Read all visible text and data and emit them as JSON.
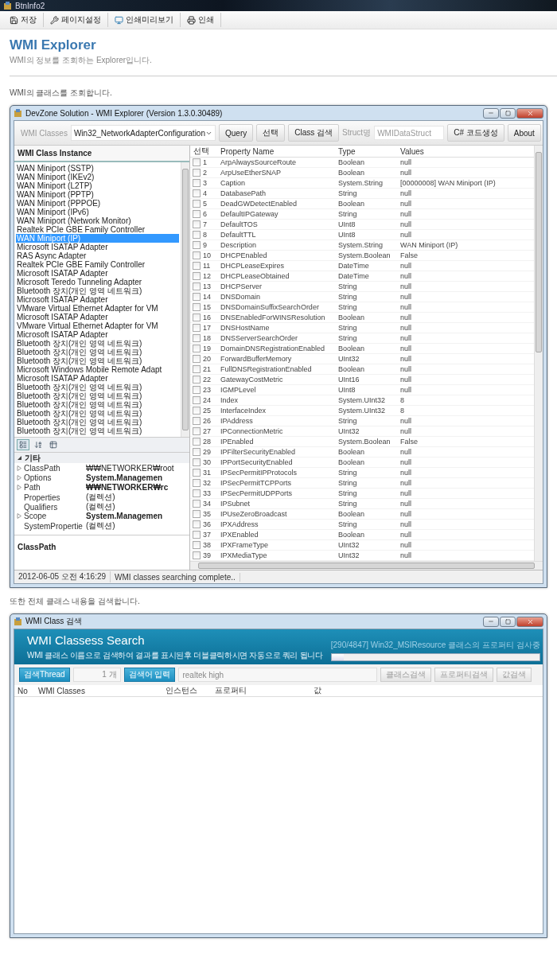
{
  "app": {
    "title": "BtnInfo2",
    "toolbar": [
      {
        "label": "저장"
      },
      {
        "label": "페이지설정"
      },
      {
        "label": "인쇄미리보기"
      },
      {
        "label": "인쇄"
      }
    ]
  },
  "header": {
    "title": "WMI Explorer",
    "subtitle": "WMI의 정보를 조회하는 Explorer입니다."
  },
  "section_1": "WMI의 클래스를 조회합니다.",
  "explorer_window": {
    "title": "DevZone Solution - WMI Explorer (Version 1.3.0.30489)",
    "toolbar": {
      "classes_label": "WMI Classes",
      "classes_value": "Win32_NetworkAdapterConfiguration",
      "buttons": [
        "Query",
        "선택",
        "Class 검색"
      ],
      "struct_label": "Struct명",
      "struct_value": "WMIDataStruct",
      "code_button": "C# 코드생성",
      "about_button": "About"
    },
    "instance_panel": {
      "title": "WMI Class Instance",
      "items": [
        {
          "label": "WAN Miniport (SSTP)",
          "selected": false
        },
        {
          "label": "WAN Miniport (IKEv2)",
          "selected": false
        },
        {
          "label": "WAN Miniport (L2TP)",
          "selected": false
        },
        {
          "label": "WAN Miniport (PPTP)",
          "selected": false
        },
        {
          "label": "WAN Miniport (PPPOE)",
          "selected": false
        },
        {
          "label": "WAN Miniport (IPv6)",
          "selected": false
        },
        {
          "label": "WAN Miniport (Network Monitor)",
          "selected": false
        },
        {
          "label": "Realtek PCIe GBE Family Controller",
          "selected": false
        },
        {
          "label": "WAN Miniport (IP)",
          "selected": true
        },
        {
          "label": "Microsoft ISATAP Adapter",
          "selected": false
        },
        {
          "label": "RAS Async Adapter",
          "selected": false
        },
        {
          "label": "Realtek PCIe GBE Family Controller",
          "selected": false
        },
        {
          "label": "Microsoft ISATAP Adapter",
          "selected": false
        },
        {
          "label": "Microsoft Teredo Tunneling Adapter",
          "selected": false
        },
        {
          "label": "Bluetooth 장치(개인 영역 네트워크)",
          "selected": false
        },
        {
          "label": "Microsoft ISATAP Adapter",
          "selected": false
        },
        {
          "label": "VMware Virtual Ethernet Adapter for VM",
          "selected": false
        },
        {
          "label": "Microsoft ISATAP Adapter",
          "selected": false
        },
        {
          "label": "VMware Virtual Ethernet Adapter for VM",
          "selected": false
        },
        {
          "label": "Microsoft ISATAP Adapter",
          "selected": false
        },
        {
          "label": "Bluetooth 장치(개인 영역 네트워크)",
          "selected": false
        },
        {
          "label": "Bluetooth 장치(개인 영역 네트워크)",
          "selected": false
        },
        {
          "label": "Bluetooth 장치(개인 영역 네트워크)",
          "selected": false
        },
        {
          "label": "Microsoft Windows Mobile Remote Adapt",
          "selected": false
        },
        {
          "label": "Microsoft ISATAP Adapter",
          "selected": false
        },
        {
          "label": "Bluetooth 장치(개인 영역 네트워크)",
          "selected": false
        },
        {
          "label": "Bluetooth 장치(개인 영역 네트워크)",
          "selected": false
        },
        {
          "label": "Bluetooth 장치(개인 영역 네트워크)",
          "selected": false
        },
        {
          "label": "Bluetooth 장치(개인 영역 네트워크)",
          "selected": false
        },
        {
          "label": "Bluetooth 장치(개인 영역 네트워크)",
          "selected": false
        },
        {
          "label": "Bluetooth 장치(개인 영역 네트워크)",
          "selected": false
        }
      ]
    },
    "property_grid": {
      "category": "기타",
      "expanded": true,
      "rows": [
        {
          "name": "ClassPath",
          "value": "₩₩NETWORKER₩root",
          "bold": false,
          "expandable": true
        },
        {
          "name": "Options",
          "value": "System.Managemen",
          "bold": true,
          "expandable": true
        },
        {
          "name": "Path",
          "value": "₩₩NETWORKER₩rc",
          "bold": true,
          "expandable": true
        },
        {
          "name": "Properties",
          "value": "(컬렉션)",
          "bold": false,
          "expandable": false
        },
        {
          "name": "Qualifiers",
          "value": "(컬렉션)",
          "bold": false,
          "expandable": false
        },
        {
          "name": "Scope",
          "value": "System.Managemen",
          "bold": true,
          "expandable": true
        },
        {
          "name": "SystemPropertie",
          "value": "(컬렉션)",
          "bold": false,
          "expandable": false
        }
      ],
      "description": "ClassPath"
    },
    "table": {
      "columns": [
        "선택",
        "Property Name",
        "Type",
        "Values"
      ],
      "rows": [
        {
          "checked": false,
          "no": "1",
          "name": "ArpAlwaysSourceRoute",
          "type": "Boolean",
          "value": "null"
        },
        {
          "checked": false,
          "no": "2",
          "name": "ArpUseEtherSNAP",
          "type": "Boolean",
          "value": "null"
        },
        {
          "checked": false,
          "no": "3",
          "name": "Caption",
          "type": "System.String",
          "value": "[00000008] WAN Miniport (IP)"
        },
        {
          "checked": false,
          "no": "4",
          "name": "DatabasePath",
          "type": "String",
          "value": "null"
        },
        {
          "checked": false,
          "no": "5",
          "name": "DeadGWDetectEnabled",
          "type": "Boolean",
          "value": "null"
        },
        {
          "checked": false,
          "no": "6",
          "name": "DefaultIPGateway",
          "type": "String",
          "value": "null"
        },
        {
          "checked": false,
          "no": "7",
          "name": "DefaultTOS",
          "type": "UInt8",
          "value": "null"
        },
        {
          "checked": false,
          "no": "8",
          "name": "DefaultTTL",
          "type": "UInt8",
          "value": "null"
        },
        {
          "checked": false,
          "no": "9",
          "name": "Description",
          "type": "System.String",
          "value": "WAN Miniport (IP)"
        },
        {
          "checked": false,
          "no": "10",
          "name": "DHCPEnabled",
          "type": "System.Boolean",
          "value": "False"
        },
        {
          "checked": false,
          "no": "11",
          "name": "DHCPLeaseExpires",
          "type": "DateTime",
          "value": "null"
        },
        {
          "checked": false,
          "no": "12",
          "name": "DHCPLeaseObtained",
          "type": "DateTime",
          "value": "null"
        },
        {
          "checked": false,
          "no": "13",
          "name": "DHCPServer",
          "type": "String",
          "value": "null"
        },
        {
          "checked": false,
          "no": "14",
          "name": "DNSDomain",
          "type": "String",
          "value": "null"
        },
        {
          "checked": false,
          "no": "15",
          "name": "DNSDomainSuffixSearchOrder",
          "type": "String",
          "value": "null"
        },
        {
          "checked": false,
          "no": "16",
          "name": "DNSEnabledForWINSResolution",
          "type": "Boolean",
          "value": "null"
        },
        {
          "checked": false,
          "no": "17",
          "name": "DNSHostName",
          "type": "String",
          "value": "null"
        },
        {
          "checked": false,
          "no": "18",
          "name": "DNSServerSearchOrder",
          "type": "String",
          "value": "null"
        },
        {
          "checked": false,
          "no": "19",
          "name": "DomainDNSRegistrationEnabled",
          "type": "Boolean",
          "value": "null"
        },
        {
          "checked": false,
          "no": "20",
          "name": "ForwardBufferMemory",
          "type": "UInt32",
          "value": "null"
        },
        {
          "checked": false,
          "no": "21",
          "name": "FullDNSRegistrationEnabled",
          "type": "Boolean",
          "value": "null"
        },
        {
          "checked": false,
          "no": "22",
          "name": "GatewayCostMetric",
          "type": "UInt16",
          "value": "null"
        },
        {
          "checked": false,
          "no": "23",
          "name": "IGMPLevel",
          "type": "UInt8",
          "value": "null"
        },
        {
          "checked": false,
          "no": "24",
          "name": "Index",
          "type": "System.UInt32",
          "value": "8"
        },
        {
          "checked": false,
          "no": "25",
          "name": "InterfaceIndex",
          "type": "System.UInt32",
          "value": "8"
        },
        {
          "checked": false,
          "no": "26",
          "name": "IPAddress",
          "type": "String",
          "value": "null"
        },
        {
          "checked": false,
          "no": "27",
          "name": "IPConnectionMetric",
          "type": "UInt32",
          "value": "null"
        },
        {
          "checked": false,
          "no": "28",
          "name": "IPEnabled",
          "type": "System.Boolean",
          "value": "False"
        },
        {
          "checked": false,
          "no": "29",
          "name": "IPFilterSecurityEnabled",
          "type": "Boolean",
          "value": "null"
        },
        {
          "checked": false,
          "no": "30",
          "name": "IPPortSecurityEnabled",
          "type": "Boolean",
          "value": "null"
        },
        {
          "checked": false,
          "no": "31",
          "name": "IPSecPermitIPProtocols",
          "type": "String",
          "value": "null"
        },
        {
          "checked": false,
          "no": "32",
          "name": "IPSecPermitTCPPorts",
          "type": "String",
          "value": "null"
        },
        {
          "checked": false,
          "no": "33",
          "name": "IPSecPermitUDPPorts",
          "type": "String",
          "value": "null"
        },
        {
          "checked": false,
          "no": "34",
          "name": "IPSubnet",
          "type": "String",
          "value": "null"
        },
        {
          "checked": false,
          "no": "35",
          "name": "IPUseZeroBroadcast",
          "type": "Boolean",
          "value": "null"
        },
        {
          "checked": false,
          "no": "36",
          "name": "IPXAddress",
          "type": "String",
          "value": "null"
        },
        {
          "checked": false,
          "no": "37",
          "name": "IPXEnabled",
          "type": "Boolean",
          "value": "null"
        },
        {
          "checked": false,
          "no": "38",
          "name": "IPXFrameType",
          "type": "UInt32",
          "value": "null"
        },
        {
          "checked": false,
          "no": "39",
          "name": "IPXMediaType",
          "type": "UInt32",
          "value": "null"
        }
      ]
    },
    "status_bar": [
      "2012-06-05 오전 4:16:29",
      "WMI classes searching complete.."
    ]
  },
  "section_2": "또한 전체 클래스 내용을 검색합니다.",
  "search_window": {
    "title": "WMI Class 검색",
    "banner": {
      "title": "WMI Classess Search",
      "subtitle": "WMI 클래스 이름으로 검색하여 결과를 표시된후 더블클릭하시면 자동으로 쿼리 됩니다",
      "progress_text": "[290/4847] Win32_MSIResource 클래스의 프로퍼티 검사중",
      "level": 0.06
    },
    "controls": {
      "thread_label": "검색Thread",
      "thread_value": "1 개",
      "query_label": "검색어 입력",
      "query_value": "realtek high",
      "buttons": [
        {
          "label": "클래스검색",
          "disabled": true
        },
        {
          "label": "프로퍼티검색",
          "disabled": true
        },
        {
          "label": "값검색",
          "disabled": true
        }
      ]
    },
    "columns": [
      "No",
      "WMI Classes",
      "인스턴스",
      "프로퍼티",
      "값"
    ]
  }
}
